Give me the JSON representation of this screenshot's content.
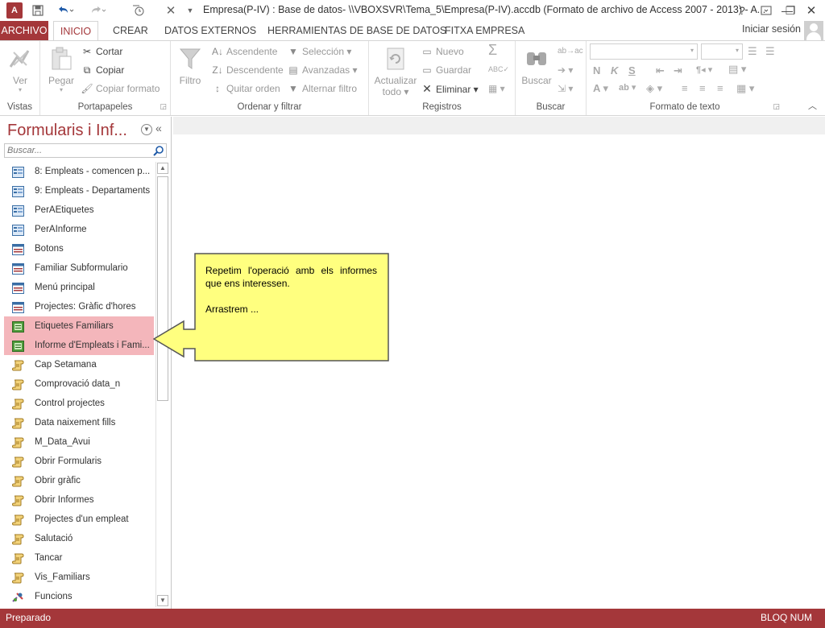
{
  "window": {
    "title": "Empresa(P-IV) : Base de datos- \\\\VBOXSVR\\Tema_5\\Empresa(P-IV).accdb (Formato de archivo de Access 2007 - 2013) - A...",
    "app_icon": "A",
    "help": "?",
    "restore_ribbon": "🗗",
    "minimize": "—",
    "maximize": "❐",
    "close": "✕"
  },
  "tabs": {
    "file": "ARCHIVO",
    "home": "INICIO",
    "create": "CREAR",
    "external": "DATOS EXTERNOS",
    "dbtools": "HERRAMIENTAS DE BASE DE DATOS",
    "custom": "FITXA EMPRESA",
    "signin": "Iniciar sesión"
  },
  "ribbon": {
    "views": {
      "label": "Vistas",
      "view": "Ver"
    },
    "clipboard": {
      "label": "Portapapeles",
      "paste": "Pegar",
      "cut": "Cortar",
      "copy": "Copiar",
      "format_painter": "Copiar formato"
    },
    "sortfilter": {
      "label": "Ordenar y filtrar",
      "filter": "Filtro",
      "ascending": "Ascendente",
      "descending": "Descendente",
      "remove_sort": "Quitar orden",
      "selection": "Selección",
      "advanced": "Avanzadas",
      "toggle_filter": "Alternar filtro"
    },
    "records": {
      "label": "Registros",
      "refresh": "Actualizar",
      "refresh2": "todo",
      "new": "Nuevo",
      "save": "Guardar",
      "delete": "Eliminar"
    },
    "find": {
      "label": "Buscar",
      "find": "Buscar"
    },
    "textformat": {
      "label": "Formato de texto",
      "bold": "N",
      "italic": "K",
      "underline": "S"
    }
  },
  "navpane": {
    "title": "Formularis i Inf...",
    "search_placeholder": "Buscar...",
    "items": [
      {
        "label": "8: Empleats - comencen p...",
        "type": "form"
      },
      {
        "label": "9: Empleats - Departaments",
        "type": "form"
      },
      {
        "label": "PerAEtiquetes",
        "type": "form"
      },
      {
        "label": "PerAInforme",
        "type": "form"
      },
      {
        "label": "Botons",
        "type": "form2"
      },
      {
        "label": "Familiar Subformulario",
        "type": "form2"
      },
      {
        "label": "Menú principal",
        "type": "form2"
      },
      {
        "label": "Projectes: Gràfic d'hores",
        "type": "form2"
      },
      {
        "label": "Etiquetes Familiars",
        "type": "report",
        "selected": true
      },
      {
        "label": "Informe d'Empleats i Fami...",
        "type": "report",
        "selected": true
      },
      {
        "label": "Cap Setamana",
        "type": "macro"
      },
      {
        "label": "Comprovació data_n",
        "type": "macro"
      },
      {
        "label": "Control projectes",
        "type": "macro"
      },
      {
        "label": "Data naixement fills",
        "type": "macro"
      },
      {
        "label": "M_Data_Avui",
        "type": "macro"
      },
      {
        "label": "Obrir Formularis",
        "type": "macro"
      },
      {
        "label": "Obrir gràfic",
        "type": "macro"
      },
      {
        "label": "Obrir Informes",
        "type": "macro"
      },
      {
        "label": "Projectes d'un empleat",
        "type": "macro"
      },
      {
        "label": "Salutació",
        "type": "macro"
      },
      {
        "label": "Tancar",
        "type": "macro"
      },
      {
        "label": "Vis_Familiars",
        "type": "macro"
      },
      {
        "label": "Funcions",
        "type": "module"
      }
    ]
  },
  "callout": {
    "line1": "Repetim l'operació amb els informes que ens interessen.",
    "line2": "Arrastrem ..."
  },
  "status": {
    "left": "Preparado",
    "right": "BLOQ NUM"
  },
  "colors": {
    "accent": "#a4373a",
    "selection": "#f4b6bb",
    "callout_fill": "#ffff7f"
  }
}
